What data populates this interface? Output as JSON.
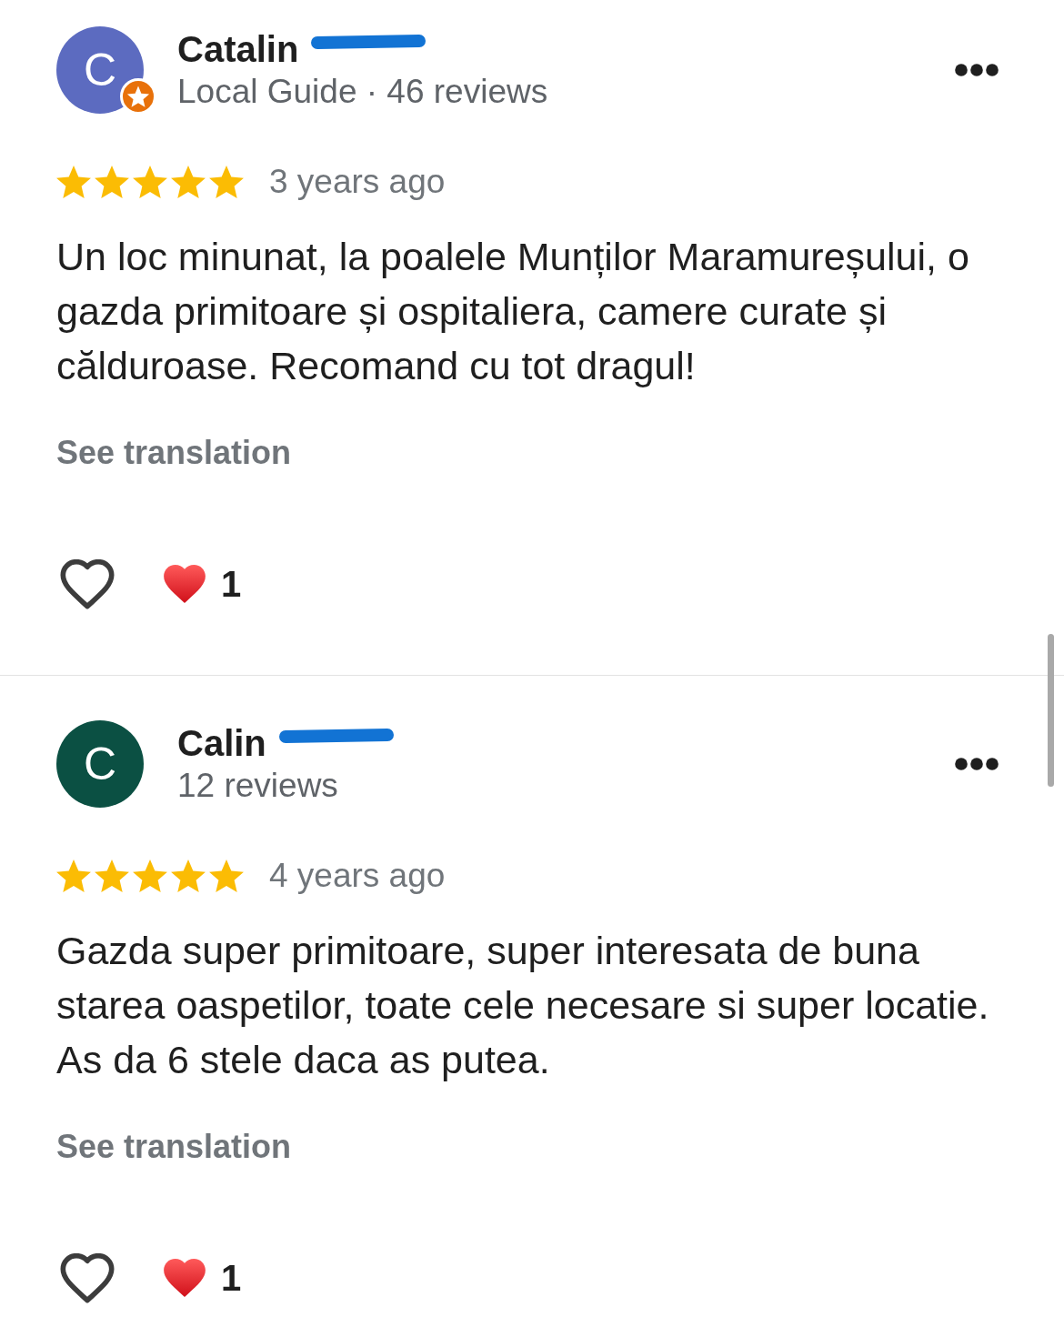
{
  "reviews": [
    {
      "avatar": {
        "letter": "C",
        "color": "#5c6bc0"
      },
      "local_guide": true,
      "name": "Catalin",
      "surname_redacted": true,
      "reviewer_stats": "Local Guide · 46 reviews",
      "stars": 5,
      "date": "3 years ago",
      "text": "Un loc minunat, la poalele Munților Maramureșului, o gazda primitoare și ospitaliera, camere curate și călduroase. Recomand cu tot dragul!",
      "see_translation": "See translation",
      "liked": false,
      "reaction_count": "1"
    },
    {
      "avatar": {
        "letter": "C",
        "color": "#0b5043"
      },
      "local_guide": false,
      "name": "Calin",
      "surname_redacted": true,
      "reviewer_stats": "12 reviews",
      "stars": 5,
      "date": "4 years ago",
      "text": "Gazda super primitoare, super interesata de buna starea oaspetilor, toate cele necesare si super locatie. As da 6 stele daca as putea.",
      "see_translation": "See translation",
      "liked": false,
      "reaction_count": "1"
    }
  ]
}
